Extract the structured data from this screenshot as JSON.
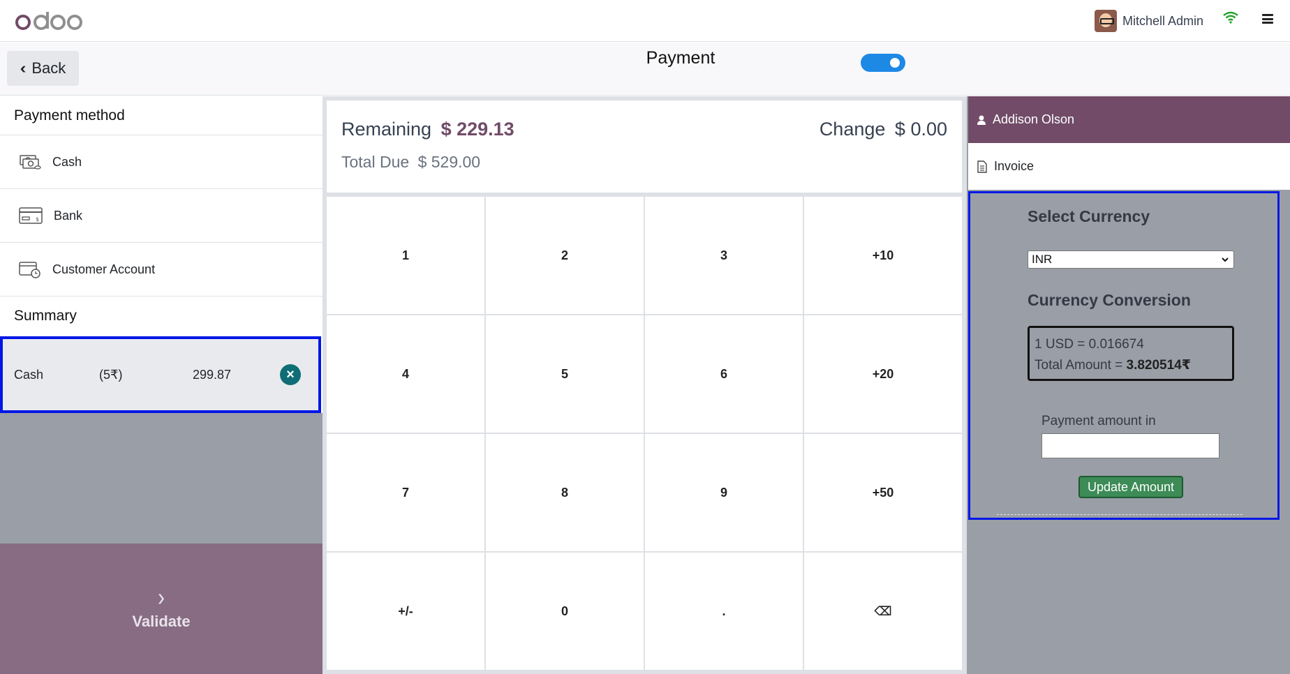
{
  "navbar": {
    "logo_text": "odoo",
    "user_name": "Mitchell Admin"
  },
  "header": {
    "back_label": "Back",
    "title": "Payment"
  },
  "payment_methods": {
    "title": "Payment method",
    "items": [
      {
        "label": "Cash",
        "icon": "cash-icon"
      },
      {
        "label": "Bank",
        "icon": "bank-card-icon"
      },
      {
        "label": "Customer Account",
        "icon": "customer-account-icon"
      }
    ]
  },
  "summary": {
    "title": "Summary",
    "line": {
      "method": "Cash",
      "currency": "(5₹)",
      "amount": "299.87"
    }
  },
  "validate_label": "Validate",
  "totals": {
    "remaining_label": "Remaining",
    "remaining_value": "$ 229.13",
    "change_label": "Change",
    "change_value": "$ 0.00",
    "total_due_label": "Total Due",
    "total_due_value": "$ 529.00"
  },
  "numpad": [
    "1",
    "2",
    "3",
    "+10",
    "4",
    "5",
    "6",
    "+20",
    "7",
    "8",
    "9",
    "+50",
    "+/-",
    "0",
    ".",
    "⌫"
  ],
  "customer": {
    "name": "Addison Olson",
    "invoice_label": "Invoice"
  },
  "currency_panel": {
    "select_title": "Select Currency",
    "selected_currency": "INR",
    "conversion_title": "Currency Conversion",
    "rate_text": "1 USD = 0.016674",
    "total_amount_label": "Total Amount = ",
    "total_amount_value": "3.820514₹",
    "payment_amount_label": "Payment amount in",
    "payment_amount_value": "",
    "update_button": "Update Amount"
  },
  "colors": {
    "brand": "#714b67",
    "highlight": "#0017e6",
    "toggle": "#1e88e5",
    "update_button": "#3d8b56"
  }
}
